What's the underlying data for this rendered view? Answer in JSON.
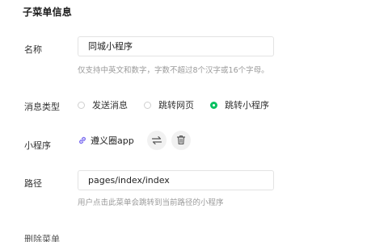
{
  "section": {
    "title": "子菜单信息"
  },
  "name_field": {
    "label": "名称",
    "value": "同城小程序",
    "hint": "仅支持中英文和数字，字数不超过8个汉字或16个字母。"
  },
  "message_type": {
    "label": "消息类型",
    "options": [
      {
        "label": "发送消息",
        "checked": false
      },
      {
        "label": "跳转网页",
        "checked": false
      },
      {
        "label": "跳转小程序",
        "checked": true
      }
    ]
  },
  "mini_program": {
    "label": "小程序",
    "name": "遵义圈app",
    "icons": {
      "link": "link-icon",
      "swap": "swap-icon",
      "delete": "trash-icon"
    }
  },
  "path_field": {
    "label": "路径",
    "value": "pages/index/index",
    "hint": "用户点击此菜单会跳转到当前路径的小程序"
  },
  "actions": {
    "delete_menu": "删除菜单"
  },
  "colors": {
    "accent": "#07c160",
    "link_icon": "#7b6cf0",
    "hint": "#9a9a9a"
  }
}
